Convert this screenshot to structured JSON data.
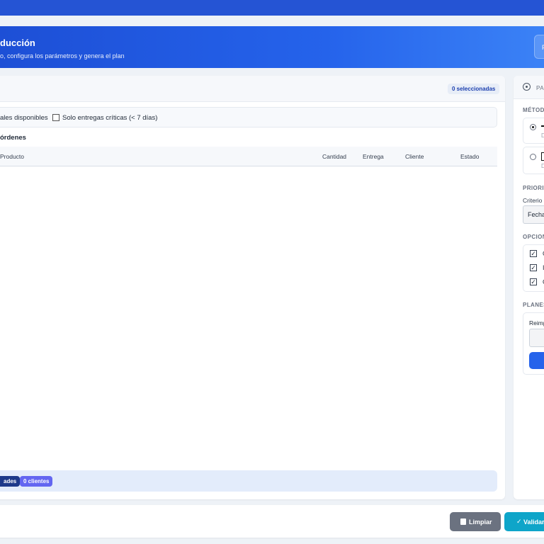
{
  "header": {
    "title": "ducción",
    "subtitle": "o, configura los parámetros y genera el plan",
    "chip_text": "P"
  },
  "orders": {
    "selected_badge": "0 seleccionadas",
    "filter_available": "ales disponibles",
    "filter_critical": "Solo entregas críticas (< 7 días)",
    "filter_critical_checked": false,
    "section_title": "órdenes",
    "columns": [
      "Producto",
      "Cantidad",
      "Entrega",
      "Cliente",
      "Estado"
    ],
    "rows": [],
    "footer_pills": [
      "ades",
      "0 clientes"
    ]
  },
  "sidebar": {
    "title": "PA",
    "method_label": "MÉTODO",
    "method_options": [
      {
        "text": "D",
        "selected": true
      },
      {
        "text": "D",
        "selected": false
      }
    ],
    "priority_label": "PRIORIZ",
    "criteria_label": "Criterio",
    "criteria_value": "Fecha",
    "options_label": "OPCION",
    "options": [
      {
        "text": "C",
        "checked": true
      },
      {
        "text": "I",
        "checked": true
      },
      {
        "text": "C",
        "checked": true
      }
    ],
    "plans_label": "PLANES",
    "reimport_label": "Reimp"
  },
  "actions": {
    "clear_label": "Limpiar",
    "validate_label": "Validar",
    "validate_icon": "check-icon",
    "clear_icon": "trash-icon"
  },
  "colors": {
    "accent": "#2563eb",
    "clear_button": "#6b7280",
    "validate_button": "#0ea5c9"
  }
}
